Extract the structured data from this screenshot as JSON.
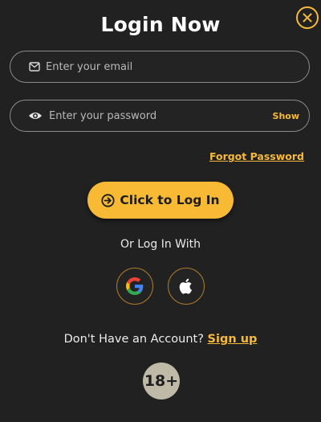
{
  "header": {
    "title": "Login Now",
    "close_icon": "close-icon"
  },
  "form": {
    "email": {
      "value": "",
      "placeholder": "Enter your email",
      "icon": "envelope-icon"
    },
    "password": {
      "value": "",
      "placeholder": "Enter your password",
      "icon": "eye-icon",
      "show_label": "Show"
    },
    "forgot_label": "Forgot Password",
    "submit_label": "Click to Log In",
    "submit_icon": "arrow-circle-right-icon"
  },
  "social": {
    "label": "Or Log In With",
    "providers": [
      {
        "name": "google",
        "icon": "google-icon"
      },
      {
        "name": "apple",
        "icon": "apple-icon"
      }
    ]
  },
  "signup": {
    "prompt": "Don't Have an Account?",
    "link_label": "Sign up"
  },
  "age_badge": "18+",
  "colors": {
    "accent": "#f6b93b",
    "background": "#212121",
    "button": "#f8b934",
    "badge": "#bfb9a8"
  }
}
